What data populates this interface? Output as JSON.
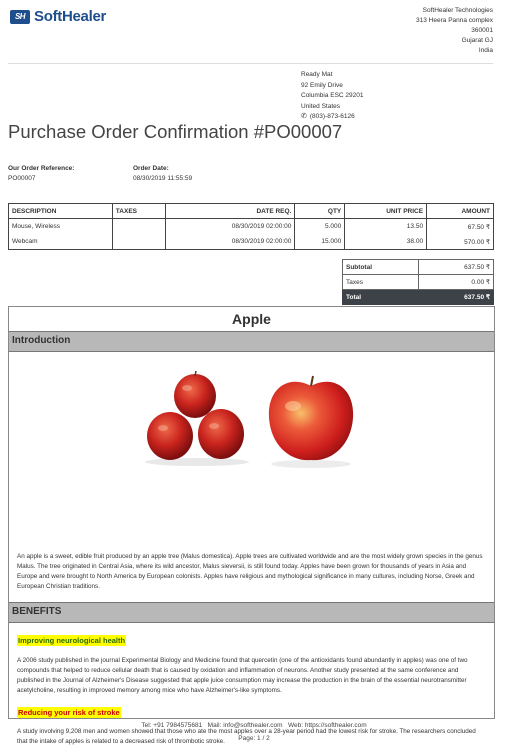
{
  "header": {
    "logo_mark": "SH",
    "logo_text": "SoftHealer",
    "company_lines": [
      "SoftHealer Technologies",
      "313 Heera Panna complex",
      "360001",
      "Gujarat GJ",
      "India"
    ]
  },
  "partner": {
    "lines": [
      "Ready Mat",
      "92 Emily Drive",
      "Columbia ESC 29201",
      "United States"
    ],
    "phone": "(803)-873-6126"
  },
  "title": "Purchase Order Confirmation #PO00007",
  "info": {
    "ref_label": "Our Order Reference:",
    "ref_value": "PO00007",
    "date_label": "Order Date:",
    "date_value": "08/30/2019 11:55:59"
  },
  "table": {
    "headers": [
      "DESCRIPTION",
      "TAXES",
      "DATE REQ.",
      "QTY",
      "UNIT PRICE",
      "AMOUNT"
    ],
    "rows": [
      [
        "Mouse, Wireless",
        "",
        "08/30/2019 02:00:00",
        "5.000",
        "13.50",
        "67.50 ₹"
      ],
      [
        "Webcam",
        "",
        "08/30/2019 02:00:00",
        "15.000",
        "38.00",
        "570.00 ₹"
      ]
    ]
  },
  "totals": {
    "subtotal_label": "Subtotal",
    "subtotal_value": "637.50 ₹",
    "taxes_label": "Taxes",
    "taxes_value": "0.00 ₹",
    "total_label": "Total",
    "total_value": "637.50 ₹"
  },
  "description": {
    "title": "Apple",
    "intro_heading": "Introduction",
    "intro_text": "An apple is a sweet, edible fruit produced by an apple tree (Malus domestica). Apple trees are cultivated worldwide and are the most widely grown species in the genus Malus. The tree originated in Central Asia, where its wild ancestor, Malus sieversii, is still found today. Apples have been grown for thousands of years in Asia and Europe and were brought to North America by European colonists. Apples have religious and mythological significance in many cultures, including Norse, Greek and European Christian traditions.",
    "benefits_heading": "BENEFITS",
    "benefit1_title": "Improving neurological health",
    "benefit1_text": "A 2006 study published in the journal Experimental Biology and Medicine found that quercetin (one of the antioxidants found abundantly in apples) was one of two compounds that helped to reduce cellular death that is caused by oxidation and inflammation of neurons. Another study presented at the same conference and published in the Journal of Alzheimer's Disease suggested that apple juice consumption may increase the production in the brain of the essential neurotransmitter acetylcholine, resulting in improved memory among mice who have Alzheimer's-like symptoms.",
    "benefit2_title": "Reducing your risk of stroke",
    "benefit2_text": "A study involving 9,208 men and women showed that those who ate the most apples over a 28-year period had the lowest risk for stroke. The researchers concluded that the intake of apples is related to a decreased risk of thrombotic stroke."
  },
  "footer": {
    "contact": "Tel: +91 7984575681   Mail: info@softhealer.com   Web: https://softhealer.com",
    "page": "Page: 1 / 2"
  },
  "colors": {
    "brand": "#1f4e8c",
    "section_header": "#b8b8b8",
    "total_row": "#3d4249",
    "highlight": "#ffff00",
    "benefit1_text": "#2a6a00",
    "benefit2_text": "#cc0000"
  }
}
